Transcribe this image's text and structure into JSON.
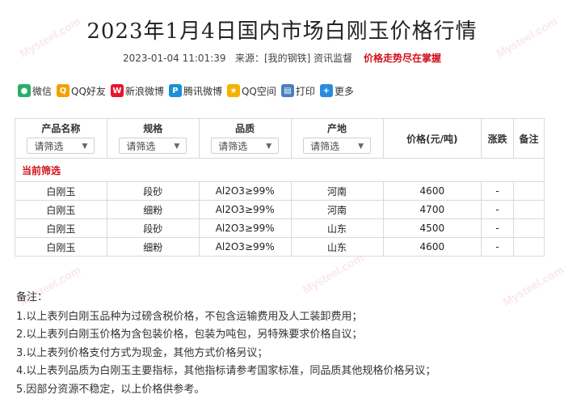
{
  "header": {
    "title": "2023年1月4日国内市场白刚玉价格行情",
    "datetime": "2023-01-04 11:01:39",
    "source_label": "来源：[我的钢铁] 资讯监督",
    "slogan": "价格走势尽在掌握"
  },
  "share": {
    "items": [
      {
        "label": "微信",
        "icon": "wechat-icon",
        "color": "#2aae67"
      },
      {
        "label": "QQ好友",
        "icon": "qq-icon",
        "color": "#f2a100"
      },
      {
        "label": "新浪微博",
        "icon": "weibo-icon",
        "color": "#e6162d"
      },
      {
        "label": "腾讯微博",
        "icon": "tencent-weibo-icon",
        "color": "#1b8fd8"
      },
      {
        "label": "QQ空间",
        "icon": "qzone-icon",
        "color": "#f5b100"
      },
      {
        "label": "打印",
        "icon": "print-icon",
        "color": "#4a7fc1"
      },
      {
        "label": "更多",
        "icon": "plus-icon",
        "color": "#2a8ae0"
      }
    ]
  },
  "table": {
    "columns": {
      "name": "产品名称",
      "spec": "规格",
      "quality": "品质",
      "origin": "产地",
      "price": "价格(元/吨)",
      "change": "涨跌",
      "note": "备注"
    },
    "filter_placeholder": "请筛选",
    "current_filter_label": "当前筛选",
    "rows": [
      {
        "name": "白刚玉",
        "spec": "段砂",
        "quality": "Al2O3≥99%",
        "origin": "河南",
        "price": "4600",
        "change": "-",
        "note": ""
      },
      {
        "name": "白刚玉",
        "spec": "细粉",
        "quality": "Al2O3≥99%",
        "origin": "河南",
        "price": "4700",
        "change": "-",
        "note": ""
      },
      {
        "name": "白刚玉",
        "spec": "段砂",
        "quality": "Al2O3≥99%",
        "origin": "山东",
        "price": "4500",
        "change": "-",
        "note": ""
      },
      {
        "name": "白刚玉",
        "spec": "细粉",
        "quality": "Al2O3≥99%",
        "origin": "山东",
        "price": "4600",
        "change": "-",
        "note": ""
      }
    ]
  },
  "notes": {
    "heading": "备注：",
    "items": [
      "1.以上表列白刚玉品种为过磅含税价格，不包含运输费用及人工装卸费用；",
      "2.以上表列白刚玉价格为含包装价格，包装为吨包，另特殊要求价格自议；",
      "3.以上表列价格支付方式为现金，其他方式价格另议；",
      "4.以上表列品质为白刚玉主要指标，其他指标请参考国家标准，同品质其他规格价格另议；",
      "5.因部分资源不稳定，以上价格供参考。"
    ]
  },
  "watermark_text": "Mysteel.com"
}
